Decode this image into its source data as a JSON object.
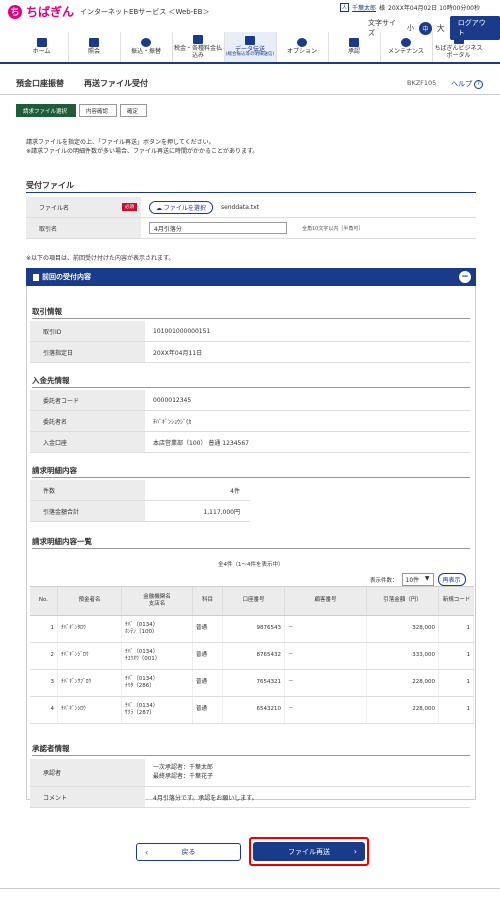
{
  "header": {
    "brand": "ちばぎん",
    "service": "インターネットEBサービス ＜Web-EB＞",
    "user_name": "千葉太郎",
    "user_suffix": "様",
    "last_login": "20XX年04月02日 10時00分00秒",
    "font_size_label": "文字サイズ",
    "font_small": "小",
    "font_mid": "中",
    "font_large": "大",
    "logout": "ログアウト"
  },
  "nav": [
    {
      "label": "ホーム"
    },
    {
      "label": "照会"
    },
    {
      "label": "振込・振替"
    },
    {
      "label": "税金・各種料金払込み"
    },
    {
      "label": "データ伝送",
      "sub": "(総合振込等の明細送信)"
    },
    {
      "label": "オプション"
    },
    {
      "label": "承認"
    },
    {
      "label": "メンテナンス"
    },
    {
      "label": "ちばぎんビジネスポータル"
    }
  ],
  "page": {
    "title": "預金口座振替",
    "subtitle": "再送ファイル受付",
    "screen_id": "BKZF105",
    "help": "ヘルプ"
  },
  "steps": [
    "請求ファイル選択",
    "内容確認",
    "確定"
  ],
  "guide": {
    "line1": "請求ファイルを指定の上、「ファイル再送」ボタンを押してください。",
    "line2": "※請求ファイルの明細件数が多い場合、ファイル再送に時間がかかることがあります。"
  },
  "receive": {
    "title": "受付ファイル",
    "file_label": "ファイル名",
    "required": "必須",
    "file_button": "ファイルを選択",
    "file_value": "senddata.txt",
    "name_label": "取引名",
    "name_value": "4月引落分",
    "name_hint": "全角10文字以内［半角可］"
  },
  "note": "※以下の項目は、前回受け付けた内容が表示されます。",
  "previous": {
    "title": "前回の受付内容",
    "trade": {
      "title": "取引情報",
      "id_label": "取引ID",
      "id_value": "101001000000151",
      "date_label": "引落指定日",
      "date_value": "20XX年04月11日"
    },
    "payee": {
      "title": "入金先情報",
      "code_label": "委託者コード",
      "code_value": "0000012345",
      "name_label": "委託者名",
      "name_value": "ﾁﾊﾞｷﾞﾝｼｮｳｼﾞ(ｶ",
      "acct_label": "入金口座",
      "acct_value": "本店営業部（100） 普通 1234567"
    },
    "summary": {
      "title": "請求明細内容",
      "count_label": "件数",
      "count_value": "4件",
      "total_label": "引落金額合計",
      "total_value": "1,117,000円"
    },
    "details": {
      "title": "請求明細内容一覧",
      "paging": "全4件（1～4件を表示中）",
      "display_count_label": "表示件数：",
      "display_count_value": "10件",
      "redisplay": "再表示",
      "headers": [
        "No.",
        "預金者名",
        "金融機関名\n支店名",
        "科目",
        "口座番号",
        "顧客番号",
        "引落金額（円）",
        "新規コード"
      ],
      "rows": [
        {
          "no": "1",
          "name": "ﾁﾊﾞｷﾞﾝﾀﾛｳ",
          "bank": "ﾁﾊﾞ（0134）",
          "branch": "ﾎﾝﾃﾝ（100）",
          "type": "普通",
          "acct": "9876543",
          "cust": "－",
          "amount": "328,000",
          "code": "1"
        },
        {
          "no": "2",
          "name": "ﾁﾊﾞｷﾞﾝｼﾞﾛｳ",
          "bank": "ﾁﾊﾞ（0134）",
          "branch": "ﾁﾕｳｵｳ（001）",
          "type": "普通",
          "acct": "8765432",
          "cust": "－",
          "amount": "333,000",
          "code": "1"
        },
        {
          "no": "3",
          "name": "ﾁﾊﾞｷﾞﾝｻﾌﾞﾛｳ",
          "bank": "ﾁﾊﾞ（0134）",
          "branch": "ﾅﾘﾀ（286）",
          "type": "普通",
          "acct": "7654321",
          "cust": "－",
          "amount": "228,000",
          "code": "1"
        },
        {
          "no": "4",
          "name": "ﾁﾊﾞｷﾞﾝｼﾛｳ",
          "bank": "ﾁﾊﾞ（0134）",
          "branch": "ｻｸﾗ（287）",
          "type": "普通",
          "acct": "6543210",
          "cust": "－",
          "amount": "228,000",
          "code": "1"
        }
      ]
    },
    "approver": {
      "title": "承認者情報",
      "label": "承認者",
      "first": "一次承認者：千葉太郎",
      "final": "最終承認者：千葉花子",
      "comment_label": "コメント",
      "comment_value": "4月引落分です。承認をお願いします。"
    }
  },
  "buttons": {
    "back": "戻る",
    "resend": "ファイル再送"
  },
  "colors": {
    "brand_pink": "#e4007f",
    "navy": "#1a3b8a",
    "step_active": "#1f5d3a",
    "highlight": "#e00000"
  }
}
